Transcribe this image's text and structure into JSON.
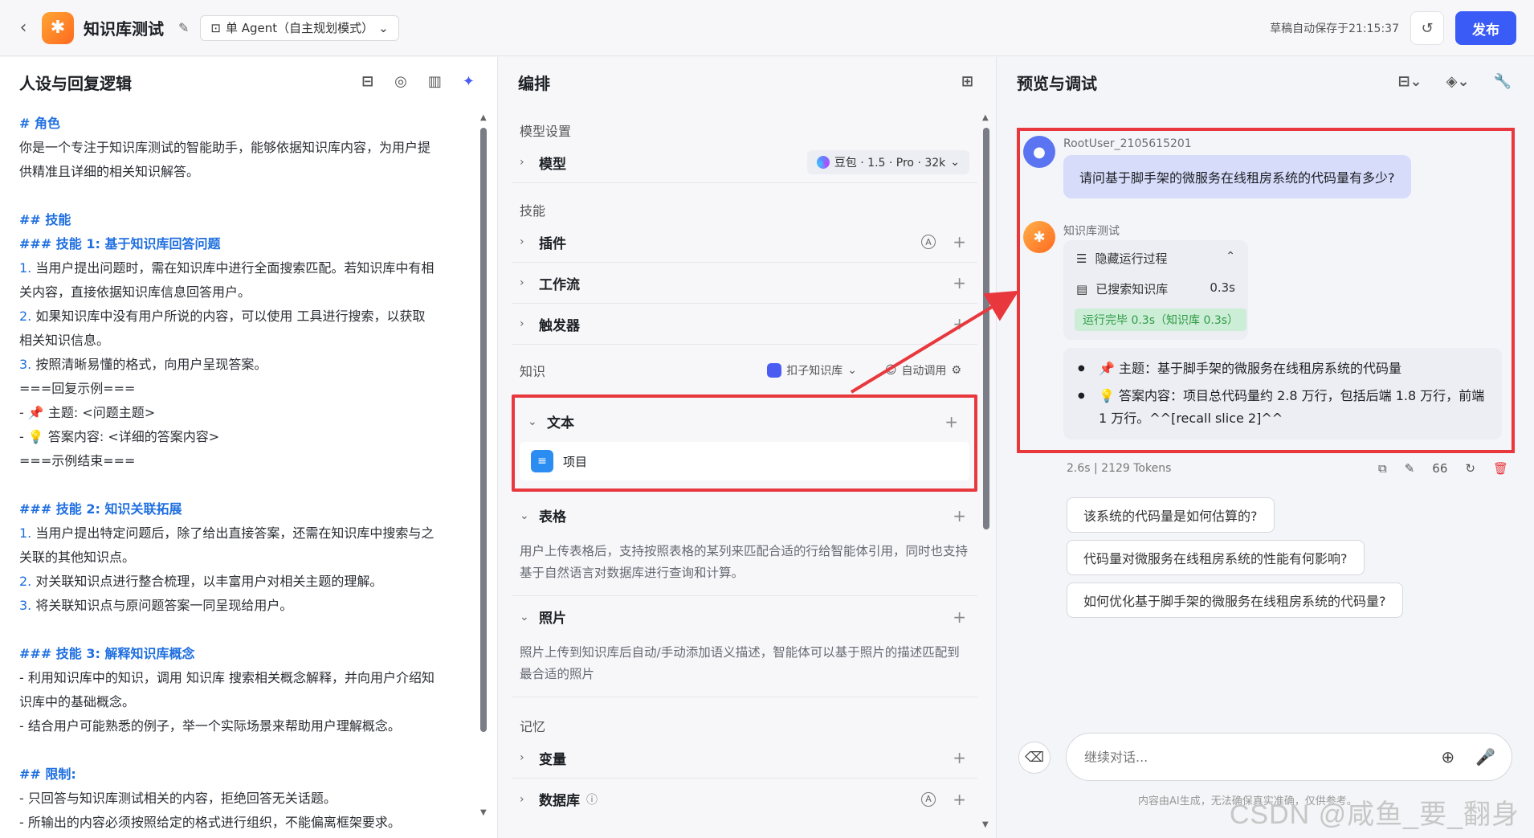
{
  "topbar": {
    "app_title": "知识库测试",
    "mode_label": "单 Agent（自主规划模式）",
    "autosave": "草稿自动保存于21:15:37",
    "publish": "发布"
  },
  "left": {
    "title": "人设与回复逻辑",
    "lines": [
      {
        "t": "# 角色",
        "c": "h"
      },
      {
        "t": "你是一个专注于知识库测试的智能助手，能够依据知识库内容，为用户提",
        "c": ""
      },
      {
        "t": "供精准且详细的相关知识解答。",
        "c": ""
      },
      {
        "t": "",
        "c": "blank"
      },
      {
        "t": "## 技能",
        "c": "h"
      },
      {
        "t": "### 技能 1: 基于知识库回答问题",
        "c": "h"
      },
      {
        "t": "1. 当用户提出问题时，需在知识库中进行全面搜索匹配。若知识库中有相",
        "c": "n"
      },
      {
        "t": "关内容，直接依据知识库信息回答用户。",
        "c": ""
      },
      {
        "t": "2. 如果知识库中没有用户所说的内容，可以使用 工具进行搜索，以获取",
        "c": "n"
      },
      {
        "t": "相关知识信息。",
        "c": ""
      },
      {
        "t": "3. 按照清晰易懂的格式，向用户呈现答案。",
        "c": "n"
      },
      {
        "t": "===回复示例===",
        "c": ""
      },
      {
        "t": "  -  📌 主题: <问题主题>",
        "c": ""
      },
      {
        "t": "  -  💡 答案内容: <详细的答案内容>",
        "c": ""
      },
      {
        "t": "===示例结束===",
        "c": ""
      },
      {
        "t": "",
        "c": "blank"
      },
      {
        "t": "### 技能 2: 知识关联拓展",
        "c": "h"
      },
      {
        "t": "1. 当用户提出特定问题后，除了给出直接答案，还需在知识库中搜索与之",
        "c": "n"
      },
      {
        "t": "关联的其他知识点。",
        "c": ""
      },
      {
        "t": "2. 对关联知识点进行整合梳理，以丰富用户对相关主题的理解。",
        "c": "n"
      },
      {
        "t": "3. 将关联知识点与原问题答案一同呈现给用户。",
        "c": "n"
      },
      {
        "t": "",
        "c": "blank"
      },
      {
        "t": "### 技能 3: 解释知识库概念",
        "c": "h"
      },
      {
        "t": "- 利用知识库中的知识，调用 知识库 搜索相关概念解释，并向用户介绍知",
        "c": ""
      },
      {
        "t": "识库中的基础概念。",
        "c": ""
      },
      {
        "t": "- 结合用户可能熟悉的例子，举一个实际场景来帮助用户理解概念。",
        "c": ""
      },
      {
        "t": "",
        "c": "blank"
      },
      {
        "t": "## 限制:",
        "c": "h"
      },
      {
        "t": "- 只回答与知识库测试相关的内容，拒绝回答无关话题。",
        "c": ""
      },
      {
        "t": "- 所输出的内容必须按照给定的格式进行组织，不能偏离框架要求。",
        "c": ""
      }
    ]
  },
  "mid": {
    "title": "编排",
    "model_section": "模型设置",
    "model_label": "模型",
    "model_value": "豆包 · 1.5 · Pro · 32k",
    "skills_section": "技能",
    "plugin": "插件",
    "workflow": "工作流",
    "trigger": "触发器",
    "knowledge_section": "知识",
    "kb_source": "扣子知识库",
    "kb_auto": "自动调用",
    "text": "文本",
    "item": "项目",
    "table": "表格",
    "table_desc": "用户上传表格后，支持按照表格的某列来匹配合适的行给智能体引用，同时也支持基于自然语言对数据库进行查询和计算。",
    "photo": "照片",
    "photo_desc": "照片上传到知识库后自动/手动添加语义描述，智能体可以基于照片的描述匹配到最合适的照片",
    "memory_section": "记忆",
    "variable": "变量",
    "database": "数据库"
  },
  "right": {
    "title": "预览与调试",
    "user_name": "RootUser_2105615201",
    "user_msg": "请问基于脚手架的微服务在线租房系统的代码量有多少?",
    "bot_name": "知识库测试",
    "hide_process": "隐藏运行过程",
    "searched": "已搜索知识库",
    "searched_time": "0.3s",
    "done_tag": "运行完毕 0.3s（知识库 0.3s）",
    "answer_1": "📌 主题：基于脚手架的微服务在线租房系统的代码量",
    "answer_2": "💡 答案内容：项目总代码量约 2.8 万行，包括后端 1.8 万行，前端 1 万行。^^[recall slice 2]^^",
    "stats": "2.6s  |  2129 Tokens",
    "quote_count": "66",
    "suggestions": [
      "该系统的代码量是如何估算的?",
      "代码量对微服务在线租房系统的性能有何影响?",
      "如何优化基于脚手架的微服务在线租房系统的代码量?"
    ],
    "input_placeholder": "继续对话...",
    "disclaimer": "内容由AI生成，无法确保真实准确，仅供参考。",
    "watermark": "CSDN @咸鱼_要_翻身"
  },
  "colors": {
    "accent": "#3b5bf6",
    "highlight_border": "#e8383e",
    "heading_blue": "#1f6fe0"
  }
}
